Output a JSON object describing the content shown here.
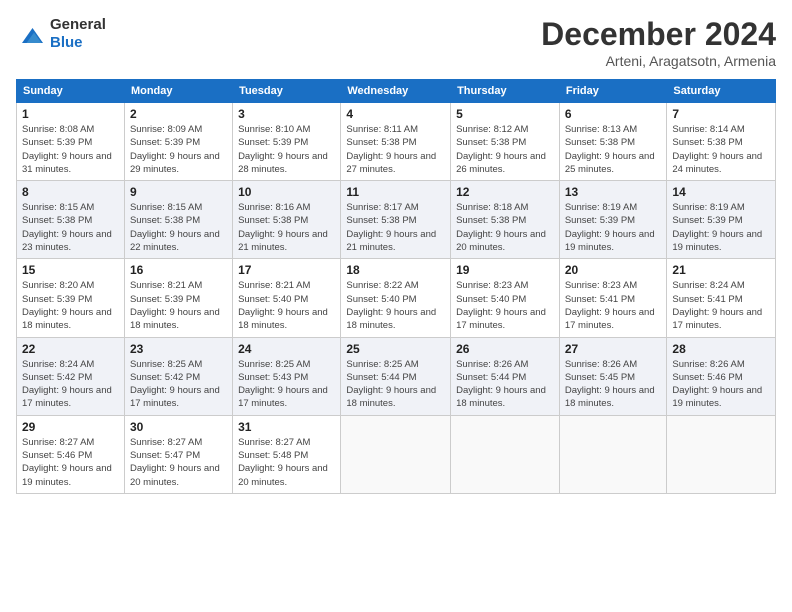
{
  "header": {
    "logo": {
      "general": "General",
      "blue": "Blue"
    },
    "title": "December 2024",
    "location": "Arteni, Aragatsotn, Armenia"
  },
  "weekdays": [
    "Sunday",
    "Monday",
    "Tuesday",
    "Wednesday",
    "Thursday",
    "Friday",
    "Saturday"
  ],
  "weeks": [
    [
      {
        "day": "1",
        "sunrise": "Sunrise: 8:08 AM",
        "sunset": "Sunset: 5:39 PM",
        "daylight": "Daylight: 9 hours and 31 minutes."
      },
      {
        "day": "2",
        "sunrise": "Sunrise: 8:09 AM",
        "sunset": "Sunset: 5:39 PM",
        "daylight": "Daylight: 9 hours and 29 minutes."
      },
      {
        "day": "3",
        "sunrise": "Sunrise: 8:10 AM",
        "sunset": "Sunset: 5:39 PM",
        "daylight": "Daylight: 9 hours and 28 minutes."
      },
      {
        "day": "4",
        "sunrise": "Sunrise: 8:11 AM",
        "sunset": "Sunset: 5:38 PM",
        "daylight": "Daylight: 9 hours and 27 minutes."
      },
      {
        "day": "5",
        "sunrise": "Sunrise: 8:12 AM",
        "sunset": "Sunset: 5:38 PM",
        "daylight": "Daylight: 9 hours and 26 minutes."
      },
      {
        "day": "6",
        "sunrise": "Sunrise: 8:13 AM",
        "sunset": "Sunset: 5:38 PM",
        "daylight": "Daylight: 9 hours and 25 minutes."
      },
      {
        "day": "7",
        "sunrise": "Sunrise: 8:14 AM",
        "sunset": "Sunset: 5:38 PM",
        "daylight": "Daylight: 9 hours and 24 minutes."
      }
    ],
    [
      {
        "day": "8",
        "sunrise": "Sunrise: 8:15 AM",
        "sunset": "Sunset: 5:38 PM",
        "daylight": "Daylight: 9 hours and 23 minutes."
      },
      {
        "day": "9",
        "sunrise": "Sunrise: 8:15 AM",
        "sunset": "Sunset: 5:38 PM",
        "daylight": "Daylight: 9 hours and 22 minutes."
      },
      {
        "day": "10",
        "sunrise": "Sunrise: 8:16 AM",
        "sunset": "Sunset: 5:38 PM",
        "daylight": "Daylight: 9 hours and 21 minutes."
      },
      {
        "day": "11",
        "sunrise": "Sunrise: 8:17 AM",
        "sunset": "Sunset: 5:38 PM",
        "daylight": "Daylight: 9 hours and 21 minutes."
      },
      {
        "day": "12",
        "sunrise": "Sunrise: 8:18 AM",
        "sunset": "Sunset: 5:38 PM",
        "daylight": "Daylight: 9 hours and 20 minutes."
      },
      {
        "day": "13",
        "sunrise": "Sunrise: 8:19 AM",
        "sunset": "Sunset: 5:39 PM",
        "daylight": "Daylight: 9 hours and 19 minutes."
      },
      {
        "day": "14",
        "sunrise": "Sunrise: 8:19 AM",
        "sunset": "Sunset: 5:39 PM",
        "daylight": "Daylight: 9 hours and 19 minutes."
      }
    ],
    [
      {
        "day": "15",
        "sunrise": "Sunrise: 8:20 AM",
        "sunset": "Sunset: 5:39 PM",
        "daylight": "Daylight: 9 hours and 18 minutes."
      },
      {
        "day": "16",
        "sunrise": "Sunrise: 8:21 AM",
        "sunset": "Sunset: 5:39 PM",
        "daylight": "Daylight: 9 hours and 18 minutes."
      },
      {
        "day": "17",
        "sunrise": "Sunrise: 8:21 AM",
        "sunset": "Sunset: 5:40 PM",
        "daylight": "Daylight: 9 hours and 18 minutes."
      },
      {
        "day": "18",
        "sunrise": "Sunrise: 8:22 AM",
        "sunset": "Sunset: 5:40 PM",
        "daylight": "Daylight: 9 hours and 18 minutes."
      },
      {
        "day": "19",
        "sunrise": "Sunrise: 8:23 AM",
        "sunset": "Sunset: 5:40 PM",
        "daylight": "Daylight: 9 hours and 17 minutes."
      },
      {
        "day": "20",
        "sunrise": "Sunrise: 8:23 AM",
        "sunset": "Sunset: 5:41 PM",
        "daylight": "Daylight: 9 hours and 17 minutes."
      },
      {
        "day": "21",
        "sunrise": "Sunrise: 8:24 AM",
        "sunset": "Sunset: 5:41 PM",
        "daylight": "Daylight: 9 hours and 17 minutes."
      }
    ],
    [
      {
        "day": "22",
        "sunrise": "Sunrise: 8:24 AM",
        "sunset": "Sunset: 5:42 PM",
        "daylight": "Daylight: 9 hours and 17 minutes."
      },
      {
        "day": "23",
        "sunrise": "Sunrise: 8:25 AM",
        "sunset": "Sunset: 5:42 PM",
        "daylight": "Daylight: 9 hours and 17 minutes."
      },
      {
        "day": "24",
        "sunrise": "Sunrise: 8:25 AM",
        "sunset": "Sunset: 5:43 PM",
        "daylight": "Daylight: 9 hours and 17 minutes."
      },
      {
        "day": "25",
        "sunrise": "Sunrise: 8:25 AM",
        "sunset": "Sunset: 5:44 PM",
        "daylight": "Daylight: 9 hours and 18 minutes."
      },
      {
        "day": "26",
        "sunrise": "Sunrise: 8:26 AM",
        "sunset": "Sunset: 5:44 PM",
        "daylight": "Daylight: 9 hours and 18 minutes."
      },
      {
        "day": "27",
        "sunrise": "Sunrise: 8:26 AM",
        "sunset": "Sunset: 5:45 PM",
        "daylight": "Daylight: 9 hours and 18 minutes."
      },
      {
        "day": "28",
        "sunrise": "Sunrise: 8:26 AM",
        "sunset": "Sunset: 5:46 PM",
        "daylight": "Daylight: 9 hours and 19 minutes."
      }
    ],
    [
      {
        "day": "29",
        "sunrise": "Sunrise: 8:27 AM",
        "sunset": "Sunset: 5:46 PM",
        "daylight": "Daylight: 9 hours and 19 minutes."
      },
      {
        "day": "30",
        "sunrise": "Sunrise: 8:27 AM",
        "sunset": "Sunset: 5:47 PM",
        "daylight": "Daylight: 9 hours and 20 minutes."
      },
      {
        "day": "31",
        "sunrise": "Sunrise: 8:27 AM",
        "sunset": "Sunset: 5:48 PM",
        "daylight": "Daylight: 9 hours and 20 minutes."
      },
      null,
      null,
      null,
      null
    ]
  ]
}
